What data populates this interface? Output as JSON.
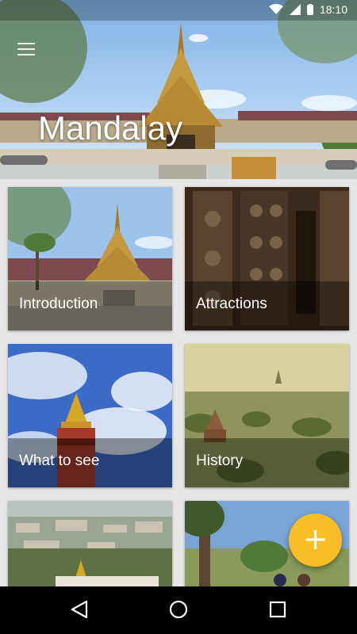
{
  "status_bar": {
    "time": "18:10"
  },
  "hero": {
    "title": "Mandalay"
  },
  "cards": [
    {
      "label": "Introduction"
    },
    {
      "label": "Attractions"
    },
    {
      "label": "What to see"
    },
    {
      "label": "History"
    },
    {
      "label": ""
    },
    {
      "label": ""
    }
  ],
  "fab": {
    "icon": "+"
  },
  "colors": {
    "accent": "#f9bd26",
    "nav_bar": "#000000",
    "background": "#e6e6e6"
  }
}
